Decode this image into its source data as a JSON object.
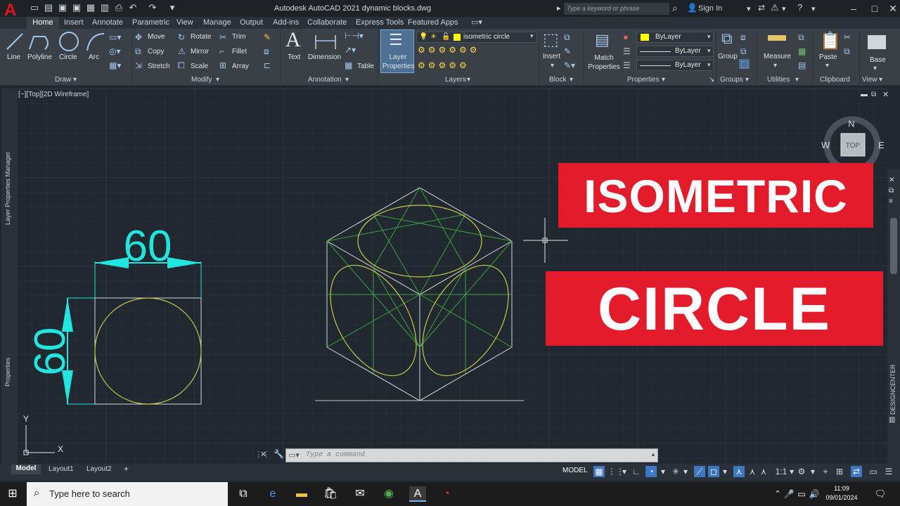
{
  "titlebar": {
    "app_title": "Autodesk AutoCAD 2021   dynamic blocks.dwg",
    "search_placeholder": "Type a keyword or phrase",
    "sign_in": "Sign In"
  },
  "ribbon_tabs": [
    "Home",
    "Insert",
    "Annotate",
    "Parametric",
    "View",
    "Manage",
    "Output",
    "Add-ins",
    "Collaborate",
    "Express Tools",
    "Featured Apps"
  ],
  "draw_panel": {
    "title": "Draw",
    "tools": [
      "Line",
      "Polyline",
      "Circle",
      "Arc"
    ]
  },
  "modify_panel": {
    "title": "Modify",
    "tools": [
      "Move",
      "Rotate",
      "Trim",
      "Copy",
      "Mirror",
      "Fillet",
      "Stretch",
      "Scale",
      "Array"
    ]
  },
  "annotation_panel": {
    "title": "Annotation",
    "tools": [
      "Text",
      "Dimension",
      "Table"
    ]
  },
  "layers_panel": {
    "title": "Layers",
    "button": "Layer\nProperties",
    "current_layer": "isometric circle",
    "layer_color": "#ffff00"
  },
  "block_panel": {
    "title": "Block",
    "tool": "Insert"
  },
  "properties_panel": {
    "title": "Properties",
    "match": "Match\nProperties",
    "color": "ByLayer",
    "linetype": "ByLayer",
    "lineweight": "ByLayer"
  },
  "groups_panel": {
    "title": "Groups",
    "tool": "Group"
  },
  "utilities_panel": {
    "title": "Utilities",
    "tool": "Measure"
  },
  "clipboard_panel": {
    "title": "Clipboard",
    "tool": "Paste"
  },
  "view_panel": {
    "title": "View",
    "tool": "Base"
  },
  "viewport": {
    "label": "[−][Top][2D Wireframe]",
    "left_palette_top": "Layer Properties Manager",
    "left_palette_bottom": "Properties",
    "right_palette": "DESIGNCENTER",
    "dim_horizontal": "60",
    "dim_vertical": "60",
    "ucs_y": "Y",
    "ucs_x": "X"
  },
  "viewcube": {
    "north": "N",
    "west": "W",
    "east": "E",
    "face": "TOP"
  },
  "overlay": {
    "line1": "ISOMETRIC",
    "line2": "CIRCLE",
    "color": "#e31b2a"
  },
  "command_line": {
    "placeholder": "Type a command"
  },
  "layout_tabs": [
    "Model",
    "Layout1",
    "Layout2"
  ],
  "status_bar": {
    "model": "MODEL",
    "scale": "1:1"
  },
  "taskbar": {
    "search_placeholder": "Type here to search",
    "time": "11:09",
    "date": "09/01/2024"
  },
  "colors": {
    "accent": "#3e78c4",
    "ribbon": "#3b4047",
    "canvas": "#212830",
    "dimension": "#20e6e0",
    "circle": "#c8c84a",
    "construction": "#3aa040"
  }
}
